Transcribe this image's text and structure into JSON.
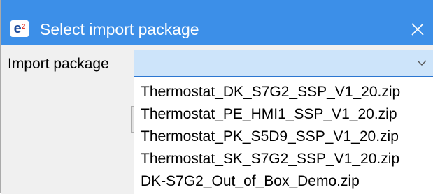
{
  "dialog": {
    "title": "Select import package",
    "icon_text": "e",
    "icon_superscript": "2",
    "icon_name": "app-e2-icon",
    "close_icon": "close-icon"
  },
  "form": {
    "import_label": "Import package",
    "selected_value": ""
  },
  "dropdown": {
    "options": [
      "Thermostat_DK_S7G2_SSP_V1_20.zip",
      "Thermostat_PE_HMI1_SSP_V1_20.zip",
      "Thermostat_PK_S5D9_SSP_V1_20.zip",
      "Thermostat_SK_S7G2_SSP_V1_20.zip",
      "DK-S7G2_Out_of_Box_Demo.zip"
    ]
  },
  "colors": {
    "titlebar": "#3c8fe8",
    "combo_focus": "#cde4fa",
    "combo_border": "#2b76d1"
  }
}
